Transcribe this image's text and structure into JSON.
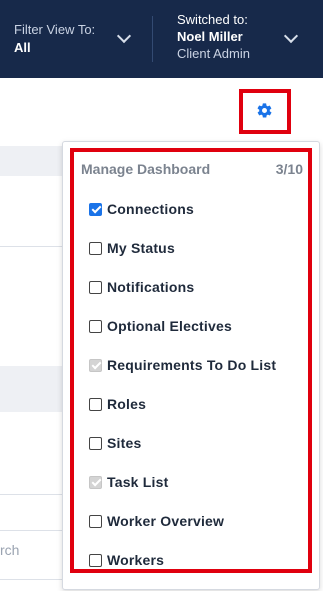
{
  "header": {
    "filter_label": "Filter View To:",
    "filter_value": "All",
    "switched_label": "Switched to:",
    "user_name": "Noel Miller",
    "user_role": "Client Admin"
  },
  "background": {
    "search_partial": "rch"
  },
  "settings": {
    "icon": "gear-icon",
    "accent_color": "#1a73e8",
    "highlight_color": "#e0000e"
  },
  "manage_dashboard": {
    "title": "Manage Dashboard",
    "count": "3/10",
    "items": [
      {
        "label": "Connections",
        "state": "checked"
      },
      {
        "label": "My Status",
        "state": "unchecked"
      },
      {
        "label": "Notifications",
        "state": "unchecked"
      },
      {
        "label": "Optional Electives",
        "state": "unchecked"
      },
      {
        "label": "Requirements To Do List",
        "state": "checked-disabled"
      },
      {
        "label": "Roles",
        "state": "unchecked"
      },
      {
        "label": "Sites",
        "state": "unchecked"
      },
      {
        "label": "Task List",
        "state": "checked-disabled"
      },
      {
        "label": "Worker Overview",
        "state": "unchecked"
      },
      {
        "label": "Workers",
        "state": "unchecked"
      }
    ]
  }
}
